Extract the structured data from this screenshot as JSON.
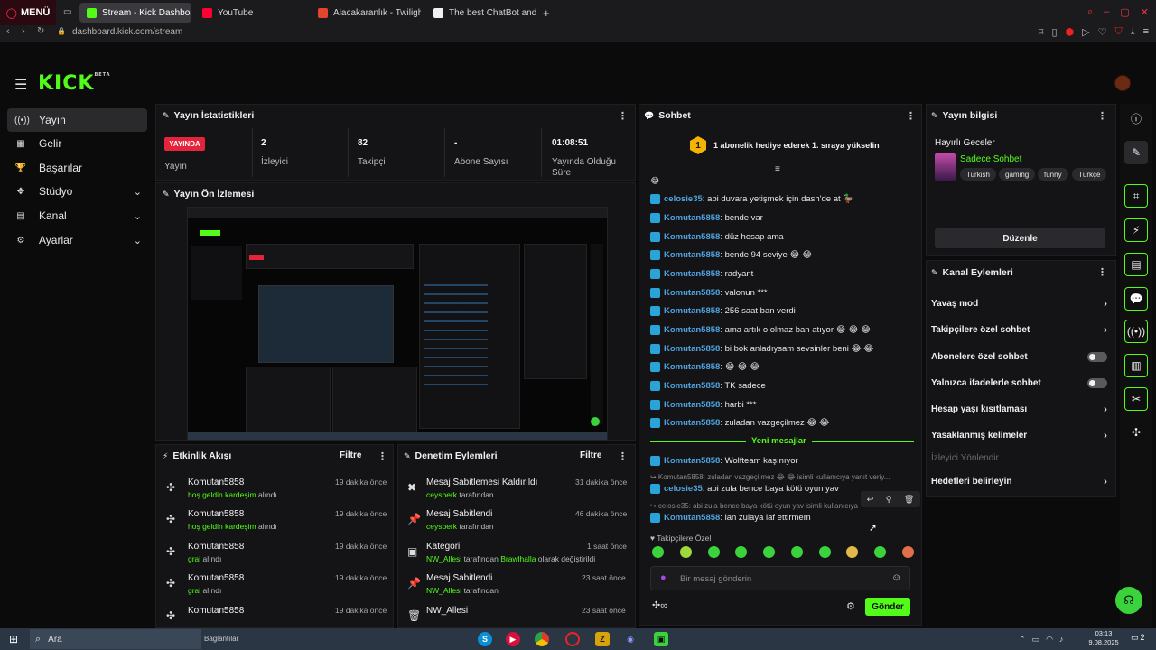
{
  "browser": {
    "menu_label": "MENÜ",
    "tabs": [
      {
        "title": "Stream - Kick Dashboard",
        "color": "#53fc18"
      },
      {
        "title": "YouTube",
        "color": "#ff0033"
      },
      {
        "title": "Alacakaranlık - Twilight i",
        "color": "#e2452b"
      },
      {
        "title": "The best ChatBot and Wi",
        "color": "#f0f0f0"
      }
    ],
    "new_tab": "+",
    "url": "dashboard.kick.com/stream"
  },
  "header": {
    "logo": "KICK",
    "logo_badge": "BETA"
  },
  "sidebar": {
    "items": [
      {
        "label": "Yayın",
        "icon": "broadcast-icon",
        "glyph": "((•))"
      },
      {
        "label": "Gelir",
        "icon": "wallet-icon",
        "glyph": "▦"
      },
      {
        "label": "Başarılar",
        "icon": "trophy-icon",
        "glyph": "🏆"
      },
      {
        "label": "Stüdyo",
        "icon": "studio-icon",
        "glyph": "✥"
      },
      {
        "label": "Kanal",
        "icon": "channel-icon",
        "glyph": "▤"
      },
      {
        "label": "Ayarlar",
        "icon": "gear-icon",
        "glyph": "⚙"
      }
    ]
  },
  "stats": {
    "title": "Yayın İstatistikleri",
    "badge": "YAYINDA",
    "badge_label": "Yayın",
    "items": [
      {
        "value": "2",
        "label": "İzleyici"
      },
      {
        "value": "82",
        "label": "Takipçi"
      },
      {
        "value": "-",
        "label": "Abone Sayısı"
      },
      {
        "value": "01:08:51",
        "label": "Yayında Olduğu Süre"
      }
    ]
  },
  "preview": {
    "title": "Yayın Ön İzlemesi"
  },
  "activity": {
    "title": "Etkinlik Akışı",
    "filter": "Filtre",
    "rows": [
      {
        "name": "Komutan5858",
        "highlight": "hoş geldin kardeşim",
        "suffix": " alındı",
        "time": "19 dakika önce"
      },
      {
        "name": "Komutan5858",
        "highlight": "hoş geldin kardeşim",
        "suffix": " alındı",
        "time": "19 dakika önce"
      },
      {
        "name": "Komutan5858",
        "highlight": "gral",
        "suffix": " alındı",
        "time": "19 dakika önce"
      },
      {
        "name": "Komutan5858",
        "highlight": "gral",
        "suffix": " alındı",
        "time": "19 dakika önce"
      },
      {
        "name": "Komutan5858",
        "highlight": "",
        "suffix": "",
        "time": "19 dakika önce"
      }
    ]
  },
  "moderation": {
    "title": "Denetim Eylemleri",
    "filter": "Filtre",
    "rows": [
      {
        "name": "Mesaj Sabitlemesi Kaldırıldı",
        "user": "ceysberk",
        "rest": " tarafından",
        "time": "31 dakika önce",
        "icon": "unpin-icon",
        "glyph": "✖"
      },
      {
        "name": "Mesaj Sabitlendi",
        "user": "ceysberk",
        "rest": " tarafından",
        "time": "46 dakika önce",
        "icon": "pin-icon",
        "glyph": "📌"
      },
      {
        "name": "Kategori",
        "user": "NW_Allesi",
        "rest": " tarafından ",
        "extra": "Brawlhalla",
        "rest2": " olarak değiştirildi",
        "time": "1 saat önce",
        "icon": "category-icon",
        "glyph": "▣"
      },
      {
        "name": "Mesaj Sabitlendi",
        "user": "NW_Allesi",
        "rest": " tarafından",
        "time": "23 saat önce",
        "icon": "pin-icon",
        "glyph": "📌"
      },
      {
        "name": "NW_Allesi",
        "user": "",
        "rest": "",
        "time": "23 saat önce",
        "icon": "trash-icon",
        "glyph": "🗑"
      }
    ]
  },
  "chat": {
    "title": "Sohbet",
    "goal_number": "1",
    "goal_text": "1 abonelik hediye ederek 1. sıraya yükselin",
    "messages": [
      {
        "user": "celosie35",
        "text": ": abi duvara yetişmek için dash'de at 🦆"
      },
      {
        "user": "Komutan5858",
        "text": ": bende var"
      },
      {
        "user": "Komutan5858",
        "text": ": düz hesap ama"
      },
      {
        "user": "Komutan5858",
        "text": ": bende 94 seviye 😂 😂"
      },
      {
        "user": "Komutan5858",
        "text": ": radyant"
      },
      {
        "user": "Komutan5858",
        "text": ": valonun ***"
      },
      {
        "user": "Komutan5858",
        "text": ": 256 saat ban verdi"
      },
      {
        "user": "Komutan5858",
        "text": ": ama artık o olmaz ban atıyor 😂 😂 😂"
      },
      {
        "user": "Komutan5858",
        "text": ": bi bok anladıysam sevsinler beni 😂 😂"
      },
      {
        "user": "Komutan5858",
        "text": ": 😂 😂 😂"
      },
      {
        "user": "Komutan5858",
        "text": ": TK sadece"
      },
      {
        "user": "Komutan5858",
        "text": ": harbi ***"
      },
      {
        "user": "Komutan5858",
        "text": ": zuladan vazgeçilmez 😂 😂"
      }
    ],
    "new_messages": "Yeni mesajlar",
    "after": [
      {
        "user": "Komutan5858",
        "text": ": Wolfteam kaşınıyor"
      }
    ],
    "reply1": "↪ Komutan5858: zuladan vazgeçilmez 😂 😂 isimli kullanıcıya yanıt veriy...",
    "msg_after_reply1": {
      "user": "celosie35",
      "text": ": abi zula bence baya kötü oyun yav"
    },
    "reply2": "↪ celosie35: abi zula bence baya kötü oyun yav isimli kullanıcıya",
    "msg_after_reply2": {
      "user": "Komutan5858",
      "text": ": lan zulaya laf ettirmem"
    },
    "followers_only": "♥ Takipçilere Özel",
    "input_placeholder": "Bir mesaj gönderin",
    "send": "Gönder"
  },
  "stream_info": {
    "title": "Yayın bilgisi",
    "stream_title": "Hayırlı Geceler",
    "category": "Sadece Sohbet",
    "tags": [
      "Turkish",
      "gaming",
      "funny",
      "Türkçe"
    ],
    "edit": "Düzenle"
  },
  "channel_actions": {
    "title": "Kanal Eylemleri",
    "items": [
      {
        "label": "Yavaş mod",
        "kind": "chevron"
      },
      {
        "label": "Takipçilere özel sohbet",
        "kind": "chevron"
      },
      {
        "label": "Abonelere özel sohbet",
        "kind": "toggle"
      },
      {
        "label": "Yalnızca ifadelerle sohbet",
        "kind": "toggle"
      },
      {
        "label": "Hesap yaşı kısıtlaması",
        "kind": "chevron"
      },
      {
        "label": "Yasaklanmış kelimeler",
        "kind": "chevron"
      },
      {
        "label": "İzleyici Yönlendir",
        "kind": "disabled"
      },
      {
        "label": "Hedefleri belirleyin",
        "kind": "chevron"
      }
    ]
  },
  "taskbar": {
    "search": "Ara",
    "news": "Bağlantılar",
    "time": "03:13",
    "date": "9.08.2025",
    "notif": "2"
  },
  "colors": {
    "brand": "#53fc18",
    "live": "#e5233a",
    "username": "#4fa3e0"
  }
}
